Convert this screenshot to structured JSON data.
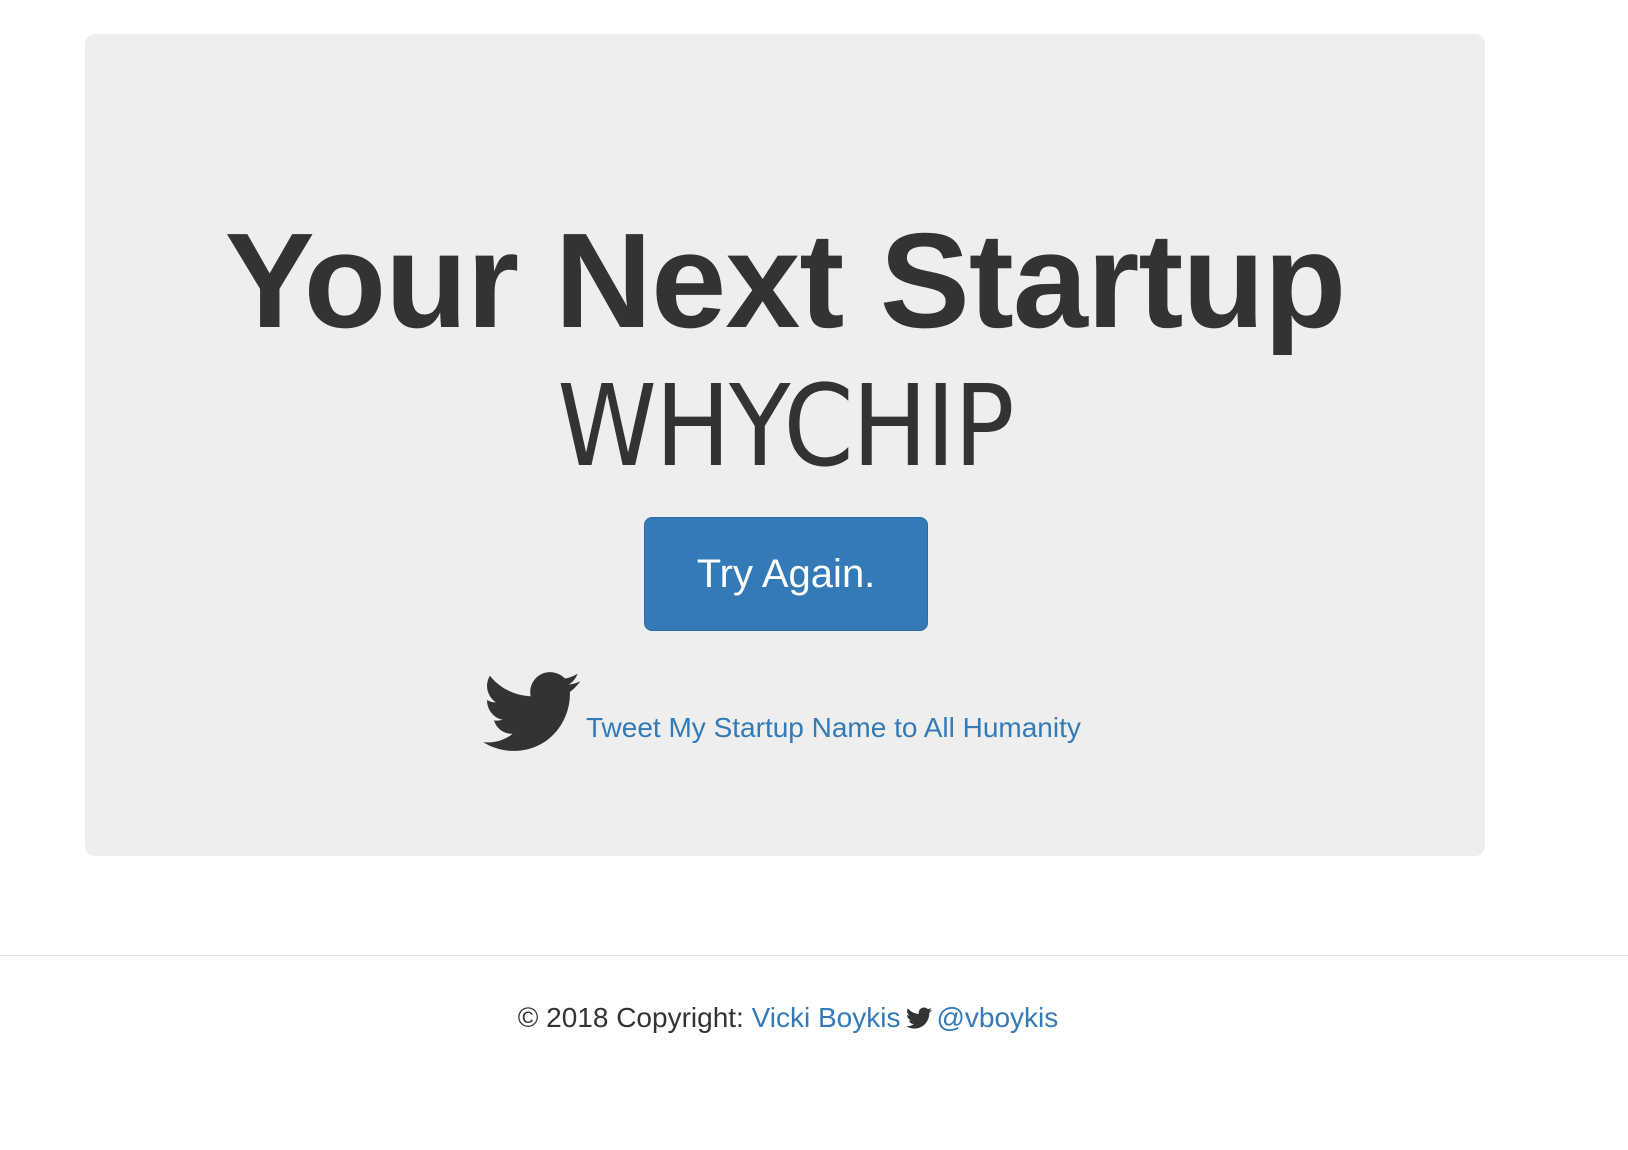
{
  "hero": {
    "title": "Your Next Startup",
    "startup_name": "WHYCHIP",
    "try_again_label": "Try Again.",
    "tweet_icon": "twitter-bird-icon",
    "tweet_link_label": "Tweet My Startup Name to All Humanity"
  },
  "footer": {
    "copyright_text": "© 2018 Copyright:",
    "author_link": "Vicki Boykis",
    "twitter_icon": "twitter-bird-icon",
    "twitter_handle": "@vboykis"
  },
  "colors": {
    "jumbotron_bg": "#eeeeee",
    "primary": "#337ab7",
    "text": "#333333"
  }
}
